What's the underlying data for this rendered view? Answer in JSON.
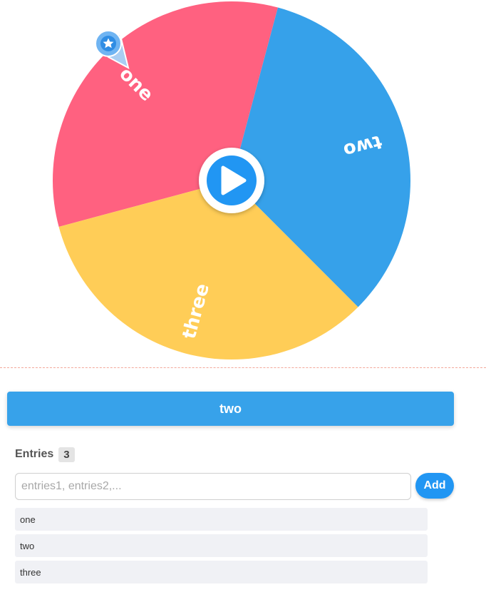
{
  "wheel": {
    "segments": [
      {
        "label": "one",
        "color": "#ff6180"
      },
      {
        "label": "two",
        "color": "#36a1ea"
      },
      {
        "label": "three",
        "color": "#ffcd57"
      }
    ],
    "spin_icon": "play-icon",
    "pointer_icon": "star-icon",
    "accent": "#2196f3"
  },
  "result": {
    "value": "two",
    "color": "#37a2ea"
  },
  "entries": {
    "title": "Entries",
    "count": "3",
    "input_placeholder": "entries1, entries2,...",
    "input_value": "",
    "add_label": "Add",
    "items": [
      "one",
      "two",
      "three"
    ]
  }
}
